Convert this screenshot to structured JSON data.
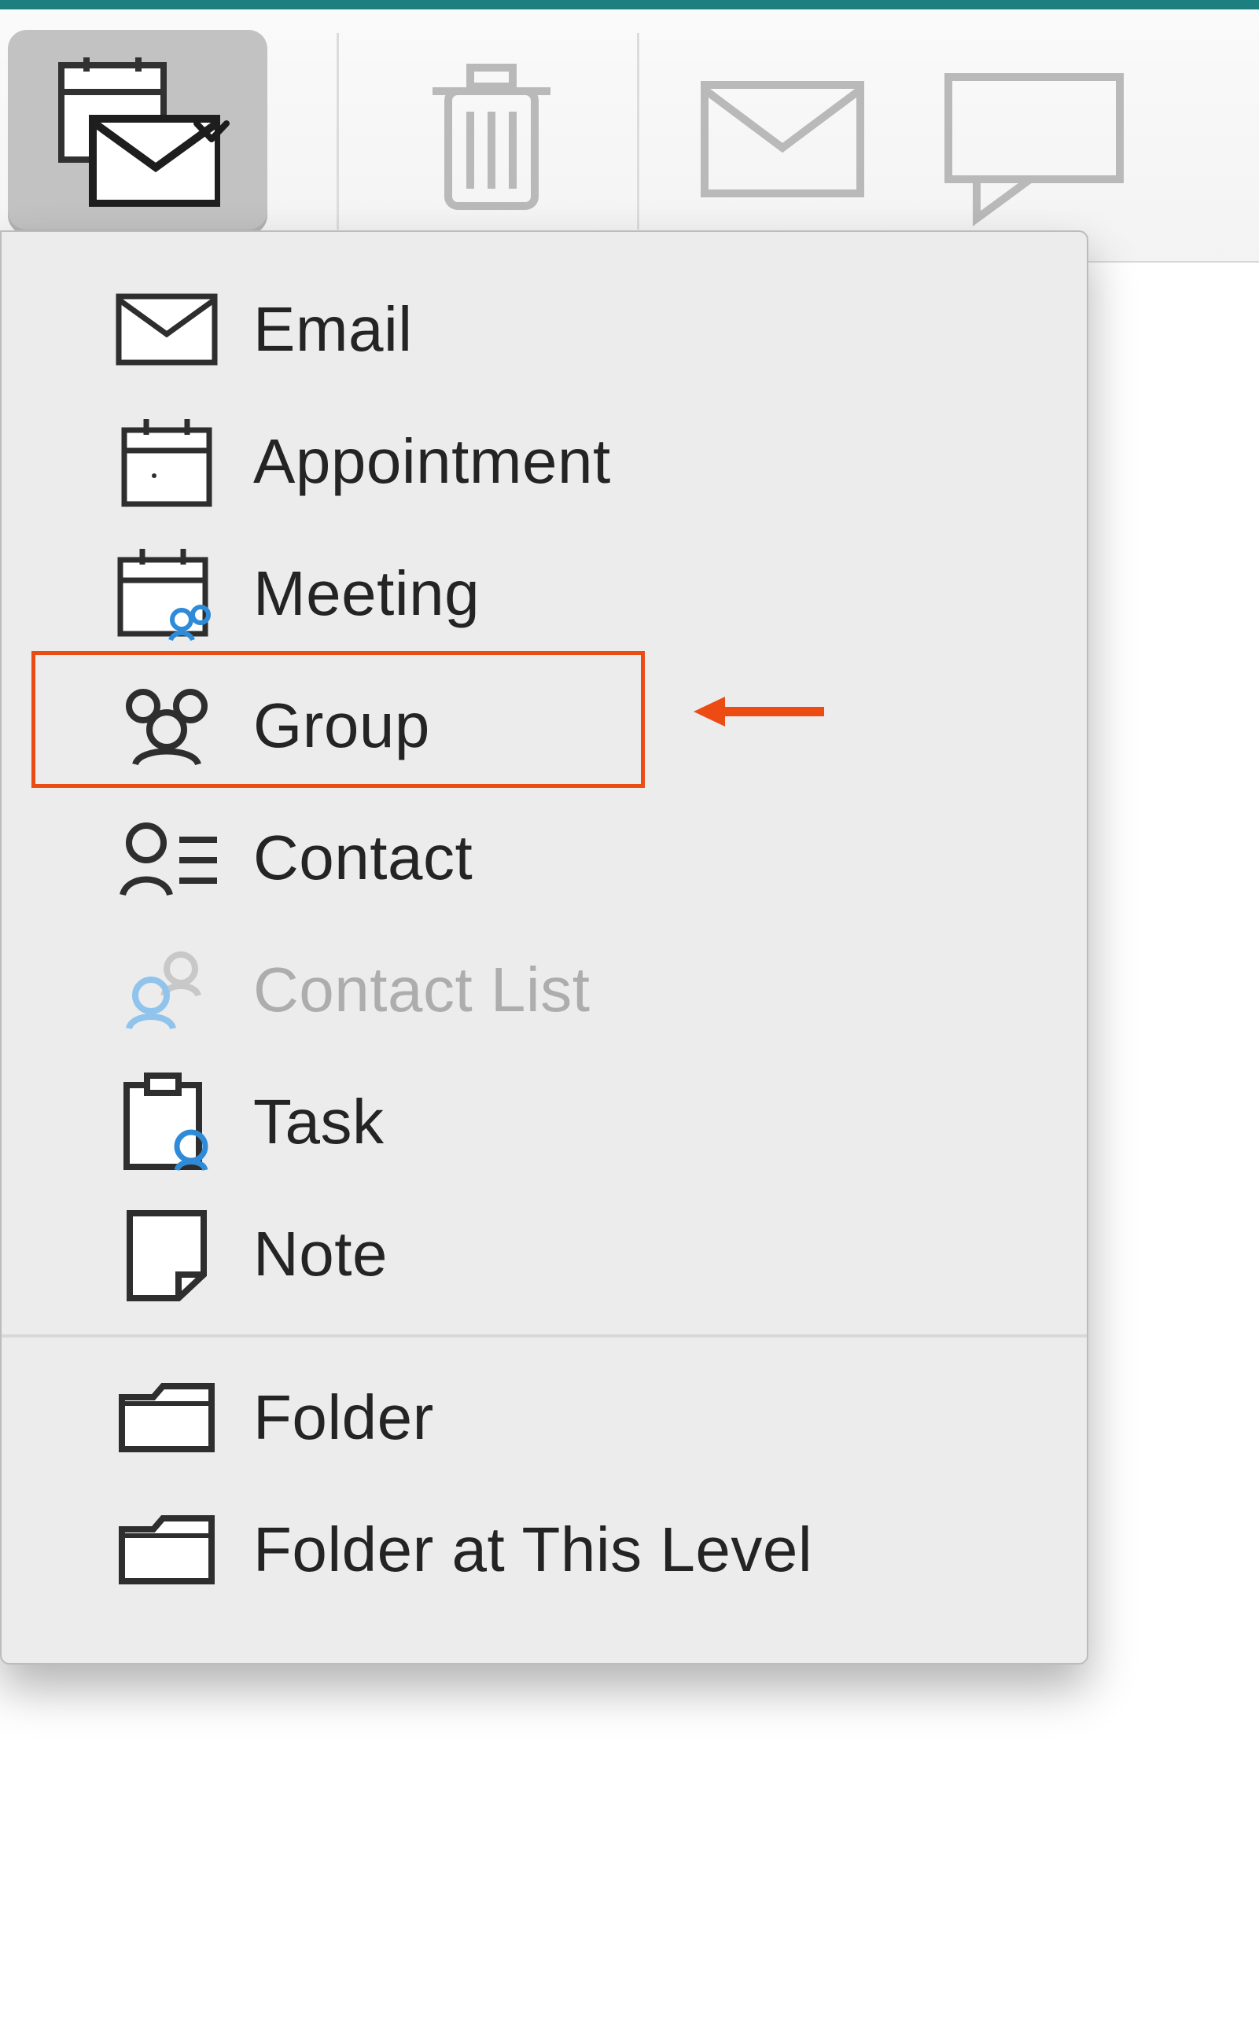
{
  "toolbar": {
    "new_btn": "New",
    "delete_btn": "Delete",
    "mail_btn": "Mail",
    "chat_btn": "Chat"
  },
  "menu": {
    "email": "Email",
    "appointment": "Appointment",
    "meeting": "Meeting",
    "group": "Group",
    "contact": "Contact",
    "contact_list": "Contact List",
    "task": "Task",
    "note": "Note",
    "folder": "Folder",
    "folder_level": "Folder at This Level"
  },
  "annotation": {
    "highlighted_item": "group"
  }
}
